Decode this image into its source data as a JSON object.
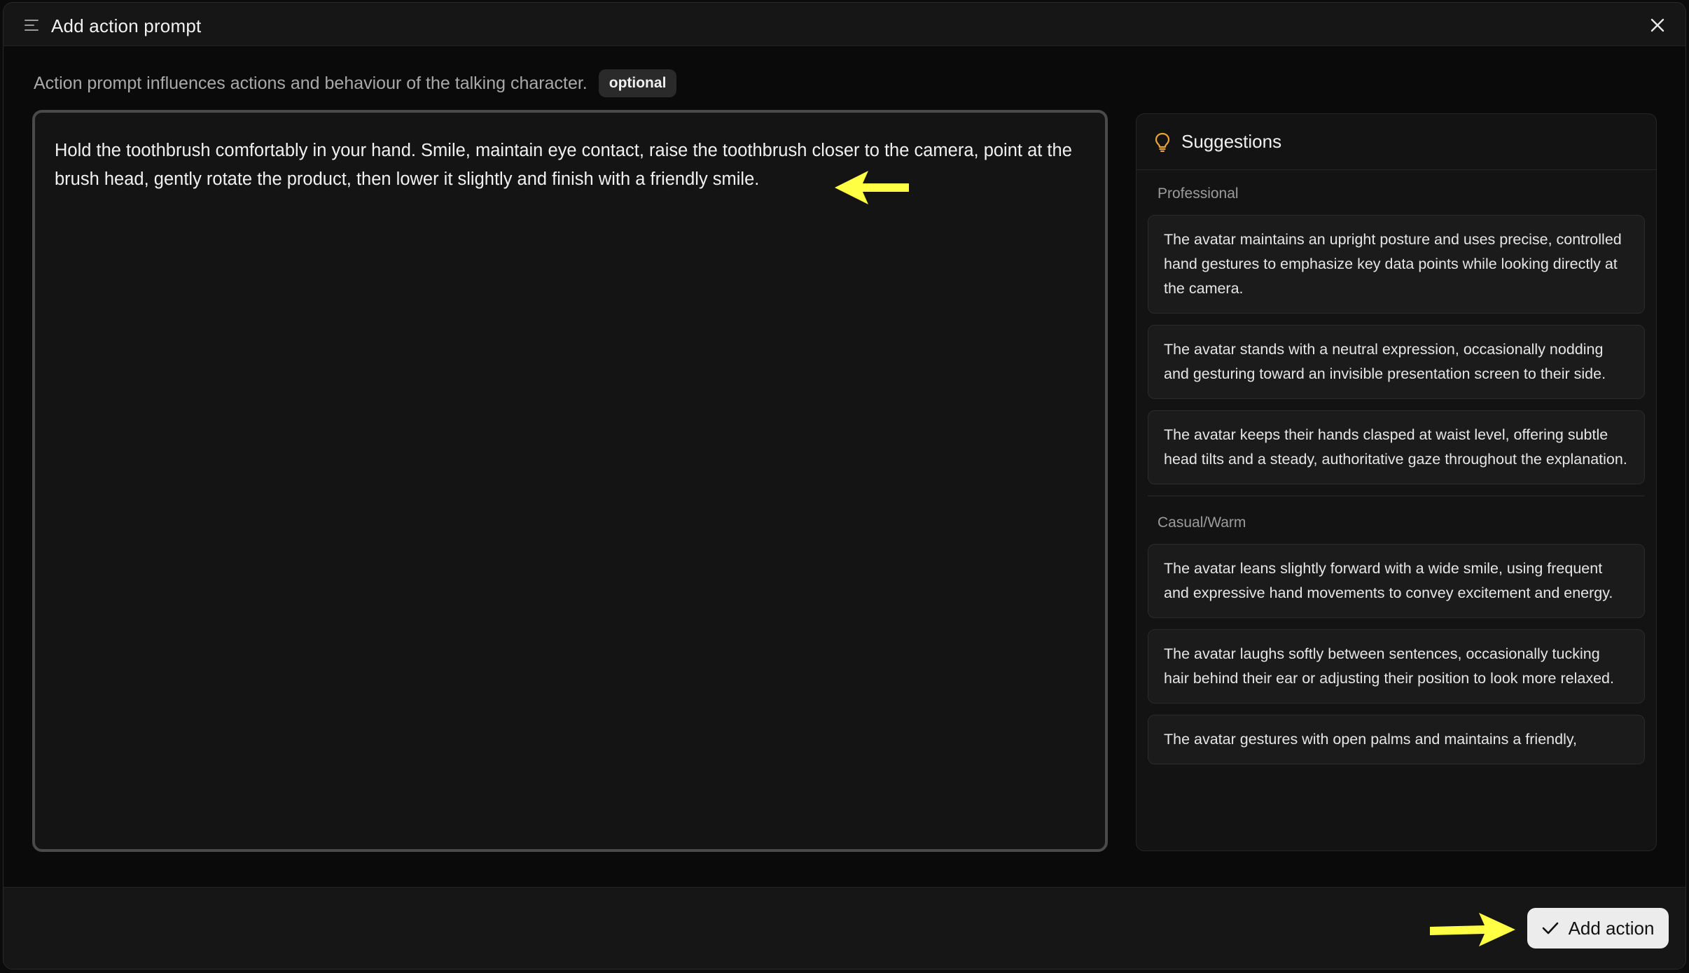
{
  "dialog": {
    "title": "Add action prompt",
    "description": "Action prompt influences actions and behaviour of the talking character.",
    "badge": "optional"
  },
  "editor": {
    "value": "Hold the toothbrush comfortably in your hand. Smile, maintain eye contact, raise the toothbrush closer to the camera, point at the brush head, gently rotate the product, then lower it slightly and finish with a friendly smile."
  },
  "suggestions": {
    "title": "Suggestions",
    "groups": [
      {
        "label": "Professional",
        "items": [
          "The avatar maintains an upright posture and uses precise, controlled hand gestures to emphasize key data points while looking directly at the camera.",
          "The avatar stands with a neutral expression, occasionally nodding and gesturing toward an invisible presentation screen to their side.",
          "The avatar keeps their hands clasped at waist level, offering subtle head tilts and a steady, authoritative gaze throughout the explanation."
        ]
      },
      {
        "label": "Casual/Warm",
        "items": [
          "The avatar leans slightly forward with a wide smile, using frequent and expressive hand movements to convey excitement and energy.",
          "The avatar laughs softly between sentences, occasionally tucking hair behind their ear or adjusting their position to look more relaxed.",
          "The avatar gestures with open palms and maintains a friendly,"
        ]
      }
    ]
  },
  "footer": {
    "add_label": "Add action"
  },
  "icons": {
    "menu": "menu-lines-icon",
    "close": "close-icon",
    "suggestions": "lightbulb-icon",
    "add": "check-icon"
  },
  "colors": {
    "accent_icon": "#e8a33a",
    "annotation": "#ffff44",
    "button_bg": "#ececec"
  }
}
